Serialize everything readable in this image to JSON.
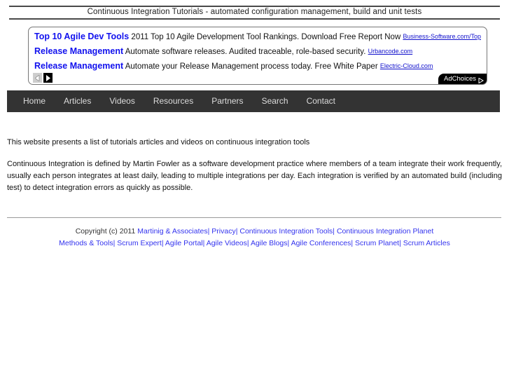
{
  "page": {
    "title": "Continuous Integration Tutorials - automated configuration management, build and unit tests"
  },
  "ads": {
    "items": [
      {
        "title": "Top 10 Agile Dev Tools",
        "description": "2011 Top 10 Agile Development Tool Rankings. Download Free Report Now",
        "display_url": "Business-Software.com/Top"
      },
      {
        "title": "Release Management",
        "description": "Automate software releases. Audited traceable, role-based security.",
        "display_url": "Urbancode.com"
      },
      {
        "title": "Release Management",
        "description": "Automate your Release Management process today. Free White Paper",
        "display_url": "Electric-Cloud.com"
      }
    ],
    "controls": {
      "prev_icon": "chevron-left-icon",
      "next_icon": "chevron-right-icon",
      "adchoices_label": "AdChoices",
      "adchoices_icon": "triangle-right-icon"
    },
    "colors": {
      "title_blue": "#1111ee",
      "url_blue": "#1111cc",
      "border": "#777777"
    }
  },
  "nav": {
    "items": [
      {
        "label": "Home"
      },
      {
        "label": "Articles"
      },
      {
        "label": "Videos"
      },
      {
        "label": "Resources"
      },
      {
        "label": "Partners"
      },
      {
        "label": "Search"
      },
      {
        "label": "Contact"
      }
    ],
    "background": "#333333",
    "text_color": "#dcdcdc"
  },
  "content": {
    "intro": "This website presents a list of tutorials articles and videos on continuous integration tools",
    "paragraph": "Continuous Integration is defined by Martin Fowler as a software development practice where members of a team integrate their work frequently, usually each person integrates at least daily, leading to multiple integrations per day. Each integration is verified by an automated build (including test) to detect integration errors as quickly as possible."
  },
  "footer": {
    "copyright": "Copyright (c) 2011",
    "line1": [
      {
        "label": "Martinig & Associates"
      },
      {
        "label": "Privacy"
      },
      {
        "label": "Continuous Integration Tools"
      },
      {
        "label": "Continuous Integration Planet"
      }
    ],
    "line2": [
      {
        "label": "Methods & Tools"
      },
      {
        "label": "Scrum Expert"
      },
      {
        "label": "Agile Portal"
      },
      {
        "label": "Agile Videos"
      },
      {
        "label": "Agile Blogs"
      },
      {
        "label": "Agile Conferences"
      },
      {
        "label": "Scrum Planet"
      },
      {
        "label": "Scrum Articles"
      }
    ],
    "separator": "|",
    "link_color": "#3333ee"
  }
}
